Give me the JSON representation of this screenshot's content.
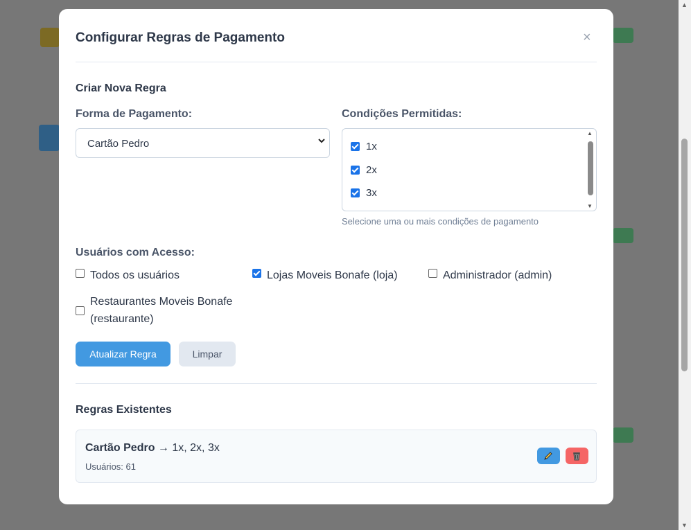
{
  "modal": {
    "title": "Configurar Regras de Pagamento",
    "close": "×"
  },
  "create": {
    "section_title": "Criar Nova Regra",
    "payment_label": "Forma de Pagamento:",
    "payment_selected": "Cartão Pedro",
    "conditions_label": "Condições Permitidas:",
    "conditions": [
      {
        "label": "1x",
        "checked": true
      },
      {
        "label": "2x",
        "checked": true
      },
      {
        "label": "3x",
        "checked": true
      }
    ],
    "conditions_hint": "Selecione uma ou mais condições de pagamento",
    "users_label": "Usuários com Acesso:",
    "users": [
      {
        "label": "Todos os usuários",
        "checked": false
      },
      {
        "label": "Lojas Moveis Bonafe (loja)",
        "checked": true
      },
      {
        "label": "Administrador (admin)",
        "checked": false
      },
      {
        "label_line1": "Restaurantes Moveis Bonafe",
        "label_line2": "(restaurante)",
        "checked": false
      }
    ],
    "update_button": "Atualizar Regra",
    "clear_button": "Limpar"
  },
  "existing": {
    "section_title": "Regras Existentes",
    "rules": [
      {
        "name": "Cartão Pedro",
        "arrow_conditions": " → 1x, 2x, 3x",
        "users": "Usuários: 61"
      }
    ]
  },
  "colors": {
    "primary": "#4299e1",
    "danger": "#f56565",
    "secondary": "#e2e8f0",
    "checkbox": "#1a73e8"
  }
}
